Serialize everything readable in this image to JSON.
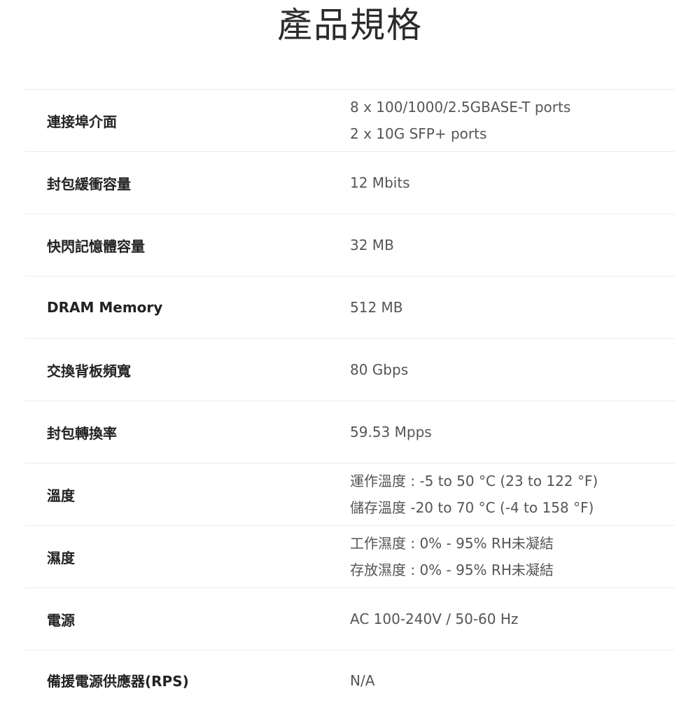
{
  "title": "產品規格",
  "specs": [
    {
      "label": "連接埠介面",
      "values": [
        "8 x 100/1000/2.5GBASE-T ports",
        "2 x 10G SFP+ ports"
      ]
    },
    {
      "label": "封包緩衝容量",
      "values": [
        "12 Mbits"
      ]
    },
    {
      "label": "快閃記憶體容量",
      "values": [
        "32 MB"
      ]
    },
    {
      "label": "DRAM Memory",
      "values": [
        "512 MB"
      ]
    },
    {
      "label": "交換背板頻寬",
      "values": [
        "80 Gbps"
      ]
    },
    {
      "label": "封包轉換率",
      "values": [
        "59.53 Mpps"
      ]
    },
    {
      "label": "溫度",
      "values": [
        "運作溫度 : -5 to 50 °C (23 to 122 °F)",
        "儲存溫度 -20 to 70 °C (-4 to 158 °F)"
      ]
    },
    {
      "label": "濕度",
      "values": [
        "工作濕度 : 0% - 95% RH未凝結",
        "存放濕度 : 0% - 95% RH未凝結"
      ]
    },
    {
      "label": "電源",
      "values": [
        "AC 100-240V / 50-60 Hz"
      ]
    },
    {
      "label": "備援電源供應器(RPS)",
      "values": [
        "N/A"
      ]
    }
  ]
}
